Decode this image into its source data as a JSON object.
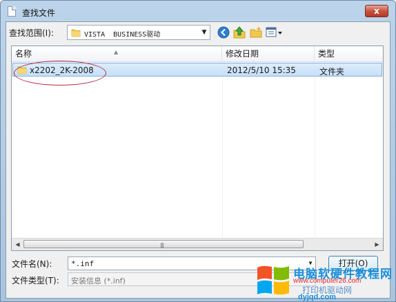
{
  "window": {
    "title": "查找文件",
    "close_label": "x"
  },
  "toolbar": {
    "look_in_label": "查找范围(I):",
    "look_in_value": "VISTA  BUSINESS驱动"
  },
  "file_list": {
    "columns": [
      "名称",
      "修改日期",
      "类型"
    ],
    "rows": [
      {
        "name": "x2202_2K-2008",
        "modified": "2012/5/10 15:35",
        "type": "文件夹"
      }
    ]
  },
  "form": {
    "file_name_label": "文件名(N):",
    "file_name_value": "*.inf",
    "file_type_label": "文件类型(T):",
    "file_type_value": "安装信息 (*.inf)",
    "open_label": "打开(O)"
  },
  "watermark": {
    "line1": "电脑软硬件教程网",
    "line2": "www.computer26.com",
    "line3": "打印机驱动网",
    "line4": "dyjqd.com"
  },
  "colors": {
    "annotation": "#b5283a",
    "selection": "#c6e0fa",
    "accent": "#3c7fb1"
  }
}
